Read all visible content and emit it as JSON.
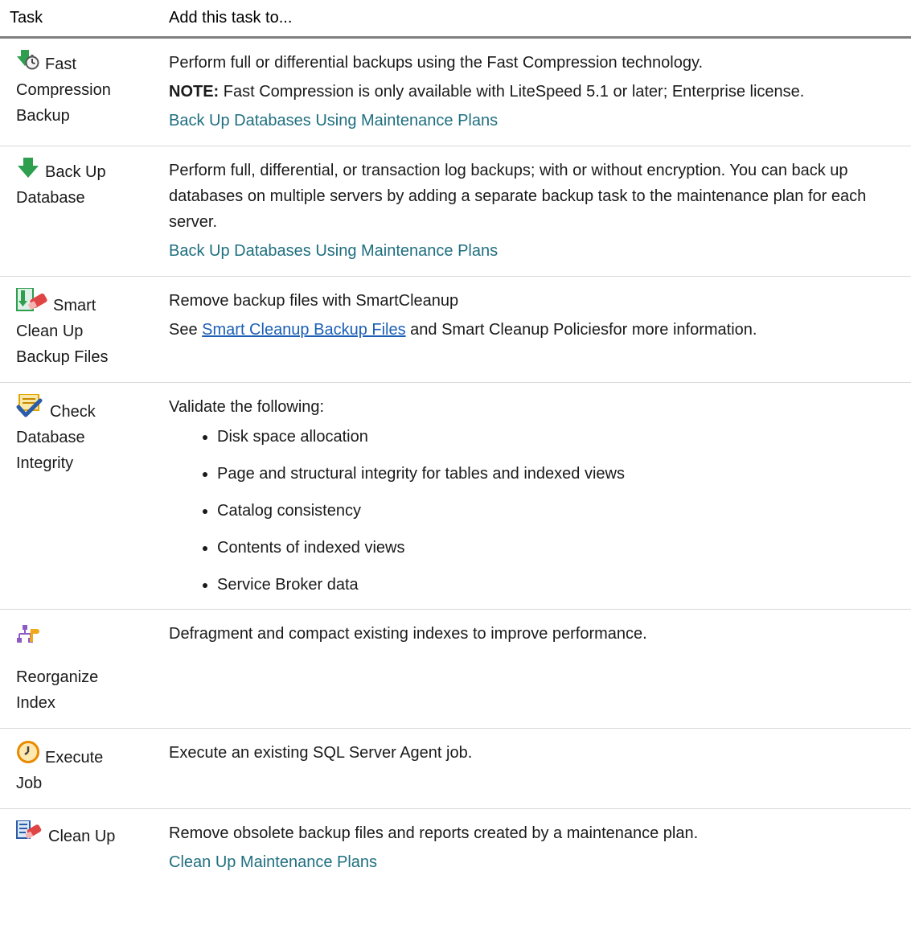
{
  "header": {
    "task": "Task",
    "add_to": "Add this task to..."
  },
  "rows": [
    {
      "icon": "fast-compression-backup-icon",
      "task_lines": [
        "Fast",
        "Compression",
        "Backup"
      ],
      "desc": "Perform full or differential backups using the Fast Compression technology.",
      "note_label": "NOTE:",
      "note_text": " Fast Compression is only available with LiteSpeed 5.1 or later; Enterprise license.",
      "link": "Back Up Databases Using Maintenance Plans"
    },
    {
      "icon": "backup-database-icon",
      "task_lines": [
        "Back Up",
        "Database"
      ],
      "desc": "Perform full, differential, or transaction log backups; with or without encryption. You can back up databases on multiple servers by adding a separate backup task to the maintenance plan for each server.",
      "link": "Back Up Databases Using Maintenance Plans"
    },
    {
      "icon": "smart-cleanup-icon",
      "task_lines": [
        "Smart",
        "Clean Up",
        "Backup Files"
      ],
      "desc": "Remove backup files with SmartCleanup",
      "see_prefix": "See ",
      "see_link": "Smart Cleanup Backup Files",
      "see_suffix": " and Smart Cleanup Policiesfor more information."
    },
    {
      "icon": "check-integrity-icon",
      "task_lines": [
        "Check",
        "Database",
        "Integrity"
      ],
      "desc": "Validate the following:",
      "bullets": [
        "Disk space allocation",
        "Page and structural integrity for tables and indexed views",
        "Catalog consistency",
        "Contents of indexed views",
        "Service Broker data"
      ]
    },
    {
      "icon": "reorganize-index-icon",
      "task_lines": [
        "Reorganize",
        "Index"
      ],
      "desc": "Defragment and compact existing indexes to improve performance."
    },
    {
      "icon": "execute-job-icon",
      "task_lines": [
        "Execute",
        "Job"
      ],
      "desc": "Execute an existing SQL Server Agent job."
    },
    {
      "icon": "cleanup-icon",
      "task_lines": [
        "Clean Up"
      ],
      "desc": "Remove obsolete backup files and reports created by a maintenance plan.",
      "link": "Clean Up Maintenance Plans"
    }
  ]
}
